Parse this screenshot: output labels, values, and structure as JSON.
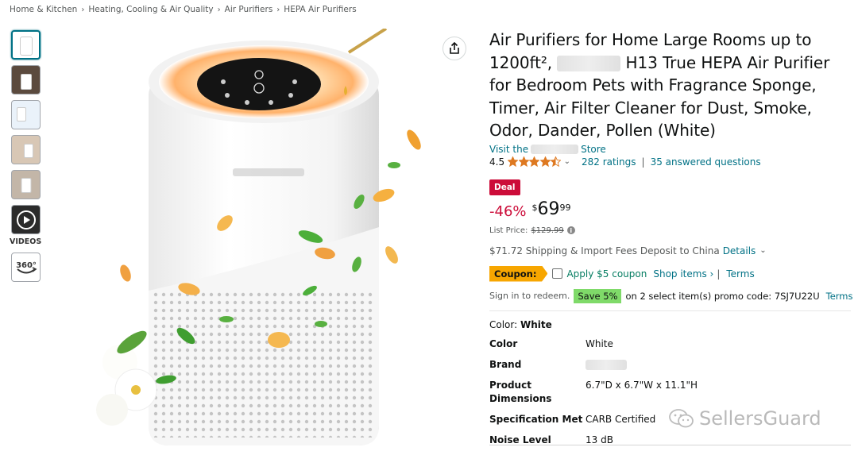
{
  "breadcrumb": [
    "Home & Kitchen",
    "Heating, Cooling & Air Quality",
    "Air Purifiers",
    "HEPA Air Purifiers"
  ],
  "gallery": {
    "videos_label": "VIDEOS",
    "spin_label": "360°"
  },
  "product": {
    "title_part1": "Air Purifiers for Home Large Rooms up to 1200ft²,",
    "title_part2": "H13 True HEPA Air Purifier for Bedroom Pets with Fragrance Sponge, Timer, Air Filter Cleaner for Dust, Smoke, Odor, Dander, Pollen (White)",
    "store_prefix": "Visit the",
    "store_suffix": "Store",
    "rating_value": "4.5",
    "rating_stars": 4.5,
    "ratings_count": "282 ratings",
    "rating_sep": "|",
    "answered": "35 answered questions"
  },
  "pricing": {
    "deal_label": "Deal",
    "discount": "-46%",
    "currency": "$",
    "price_whole": "69",
    "price_fraction": "99",
    "list_price_label": "List Price:",
    "list_price": "$129.99",
    "shipping_text": "$71.72 Shipping & Import Fees Deposit to China",
    "shipping_details": "Details"
  },
  "coupon": {
    "tag": "Coupon:",
    "apply_label": "Apply $5 coupon",
    "shop_items": "Shop items ›",
    "sep": "|",
    "terms": "Terms"
  },
  "promo": {
    "sign_in": "Sign in to redeem.",
    "save_badge": "Save 5%",
    "text": "on 2 select item(s) promo code: 7SJ7U22U",
    "terms": "Terms"
  },
  "specs": {
    "color_label": "Color:",
    "color_value": "White",
    "rows": [
      {
        "key": "Color",
        "value": "White"
      },
      {
        "key": "Brand",
        "value": ""
      },
      {
        "key": "Product Dimensions",
        "value": "6.7\"D x 6.7\"W x 11.1\"H"
      },
      {
        "key": "Specification Met",
        "value": "CARB Certified"
      },
      {
        "key": "Noise Level",
        "value": "13 dB"
      }
    ]
  },
  "watermark": "SellersGuard",
  "colors": {
    "link": "#007185",
    "deal_red": "#cc0c39",
    "star": "#de7921",
    "coupon_orange": "#f7a600",
    "save_green": "#7fda69"
  }
}
